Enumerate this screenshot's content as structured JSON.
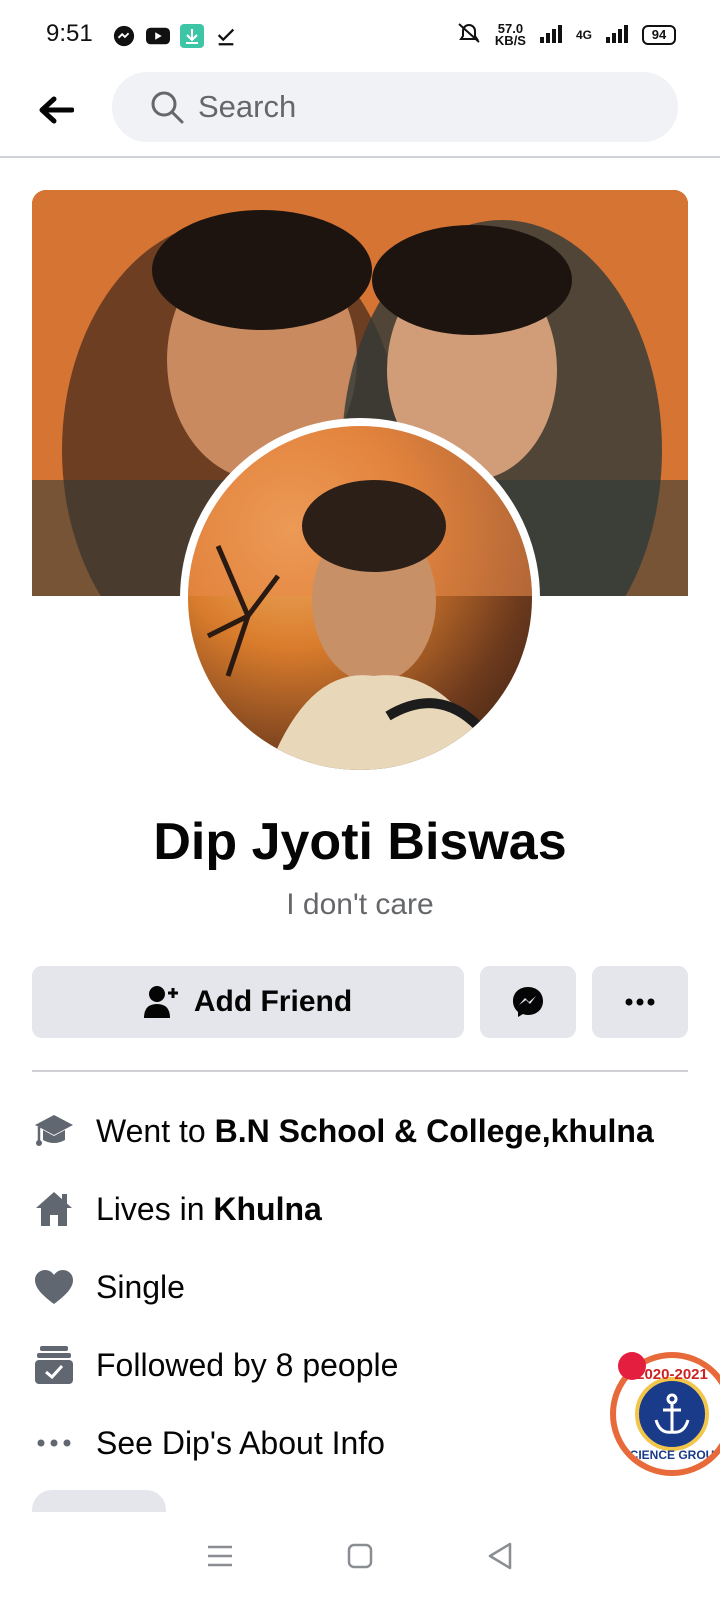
{
  "status_bar": {
    "time": "9:51",
    "network_speed_value": "57.0",
    "network_speed_unit": "KB/S",
    "network_type": "4G",
    "battery": "94"
  },
  "search": {
    "placeholder": "Search"
  },
  "profile": {
    "name": "Dip Jyoti Biswas",
    "bio": "I don't care"
  },
  "actions": {
    "add_friend_label": "Add Friend"
  },
  "info": [
    {
      "icon": "graduation-cap-icon",
      "prefix": "Went to ",
      "value": "B.N School & College,khulna"
    },
    {
      "icon": "home-icon",
      "prefix": "Lives in ",
      "value": "Khulna"
    },
    {
      "icon": "heart-icon",
      "prefix": "Single",
      "value": ""
    },
    {
      "icon": "followers-icon",
      "prefix": "Followed by 8 people",
      "value": ""
    },
    {
      "icon": "more-dots-icon",
      "prefix": "See Dip's About Info",
      "value": ""
    }
  ],
  "badge": {
    "year": "2020-2021",
    "bottom": "SCIENCE GROUP"
  },
  "colors": {
    "button_bg": "#e4e6eb",
    "search_bg": "#f0f2f5",
    "secondary_text": "#65676b",
    "icon_gray": "#606770"
  }
}
